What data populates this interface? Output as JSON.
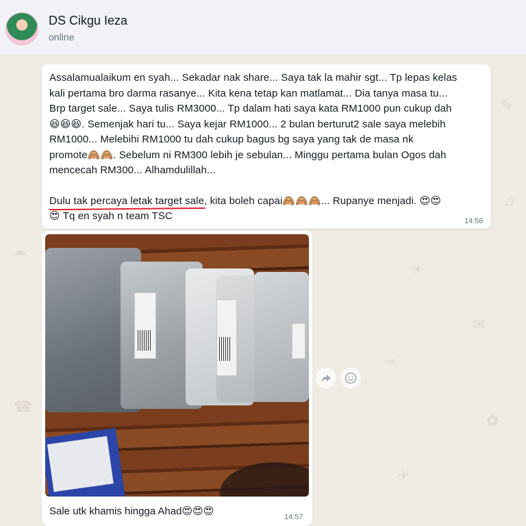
{
  "contact": {
    "name": "DS Cikgu Ieza",
    "status": "online"
  },
  "message1": {
    "p1_line1": "Assalamualaikum en syah... Sekadar nak share... Saya tak la mahir sgt... Tp lepas kelas",
    "p1_line2": "kali pertama bro darma rasanye... Kita kena tetap kan matlamat... Dia tanya masa tu...",
    "p1_line3": "Brp target sale... Saya tulis RM3000... Tp dalam hati saya kata RM1000 pun cukup dah",
    "p1_line4_emoji": "😆😆😆",
    "p1_line4_text": ". Semenjak hari tu... Saya kejar RM1000... 2 bulan berturut2 sale saya melebih",
    "p1_line5": "RM1000... Melebihi RM1000 tu dah cukup bagus bg saya yang tak de masa nk",
    "p1_line6_a": "promote",
    "p1_line6_emoji": "🙈🙈",
    "p1_line6_b": ". Sebelum ni RM300 lebih je sebulan... Minggu pertama bulan Ogos dah",
    "p1_line7": "mencecah RM300... Alhamdulillah...",
    "p2_underlined": "Dulu tak percaya letak target sale",
    "p2_after": ", kita boleh capai",
    "p2_emoji1": "🙈🙈🙈",
    "p2_after2": "... Rupanye menjadi. ",
    "p2_emoji2": "😍😍",
    "p2_line2_emoji": "😍",
    "p2_line2_text": " Tq en syah n team TSC",
    "time": "14:56"
  },
  "message2": {
    "caption_text": "Sale utk khamis hingga Ahad",
    "caption_emoji": "😍😍😍",
    "time": "14:57"
  },
  "icons": {
    "forward": "forward-icon",
    "react": "emoji-react-icon"
  },
  "colors": {
    "header_bg": "#f0f2f5",
    "chat_bg": "#efeae2",
    "bubble_bg": "#ffffff",
    "underline": "#e0202a"
  }
}
